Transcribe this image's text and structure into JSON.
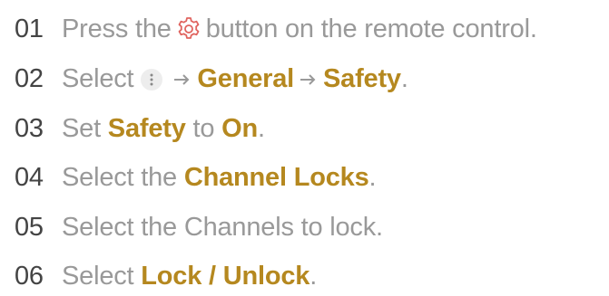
{
  "steps": [
    {
      "num": "01",
      "pre": "Press the",
      "post": "button on the remote control."
    },
    {
      "num": "02",
      "pre": "Select",
      "path": [
        "General",
        "Safety"
      ],
      "end": "."
    },
    {
      "num": "03",
      "pre": "Set",
      "setting": "Safety",
      "mid": "to",
      "value": "On",
      "end": "."
    },
    {
      "num": "04",
      "pre": "Select the",
      "target": "Channel Locks",
      "end": "."
    },
    {
      "num": "05",
      "text": "Select the Channels to lock."
    },
    {
      "num": "06",
      "pre": "Select",
      "target": "Lock / Unlock",
      "end": "."
    }
  ],
  "icons": {
    "settings": "gear-icon",
    "more": "more-options-icon",
    "arrow": "arrow-right-icon"
  },
  "colors": {
    "text": "#999999",
    "number": "#444444",
    "highlight": "#b5881f",
    "gear_icon": "#e0645f"
  }
}
